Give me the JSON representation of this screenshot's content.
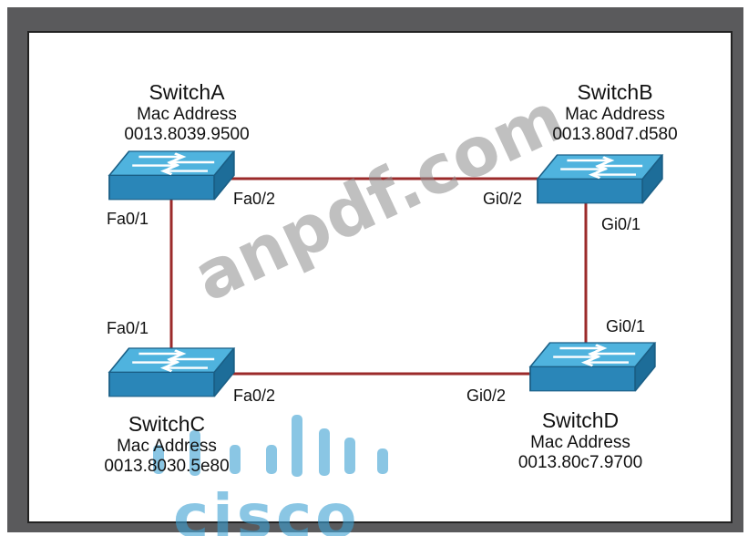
{
  "switches": [
    {
      "id": "a",
      "name": "SwitchA",
      "mac_label": "Mac Address",
      "mac": "0013.8039.9500"
    },
    {
      "id": "b",
      "name": "SwitchB",
      "mac_label": "Mac Address",
      "mac": "0013.80d7.d580"
    },
    {
      "id": "c",
      "name": "SwitchC",
      "mac_label": "Mac Address",
      "mac": "0013.8030.5e80"
    },
    {
      "id": "d",
      "name": "SwitchD",
      "mac_label": "Mac Address",
      "mac": "0013.80c7.9700"
    }
  ],
  "ports": {
    "a_left": "Fa0/1",
    "a_right": "Fa0/2",
    "b_left": "Gi0/2",
    "b_down": "Gi0/1",
    "c_up": "Fa0/1",
    "c_right": "Fa0/2",
    "d_left": "Gi0/2",
    "d_up": "Gi0/1"
  },
  "links": [
    {
      "from": "SwitchA",
      "from_port": "Fa0/2",
      "to": "SwitchB",
      "to_port": "Gi0/2"
    },
    {
      "from": "SwitchA",
      "from_port": "Fa0/1",
      "to": "SwitchC",
      "to_port": "Fa0/1"
    },
    {
      "from": "SwitchB",
      "from_port": "Gi0/1",
      "to": "SwitchD",
      "to_port": "Gi0/1"
    },
    {
      "from": "SwitchC",
      "from_port": "Fa0/2",
      "to": "SwitchD",
      "to_port": "Gi0/2"
    }
  ],
  "watermark": {
    "text": "anpdf.com",
    "brand": "cisco"
  },
  "colors": {
    "link": "#9b2a2a",
    "switch_top": "#3a9fcf",
    "switch_side": "#1f6f9c",
    "frame": "#5a5a5c"
  },
  "icons": {
    "switch": "network-switch-icon"
  }
}
